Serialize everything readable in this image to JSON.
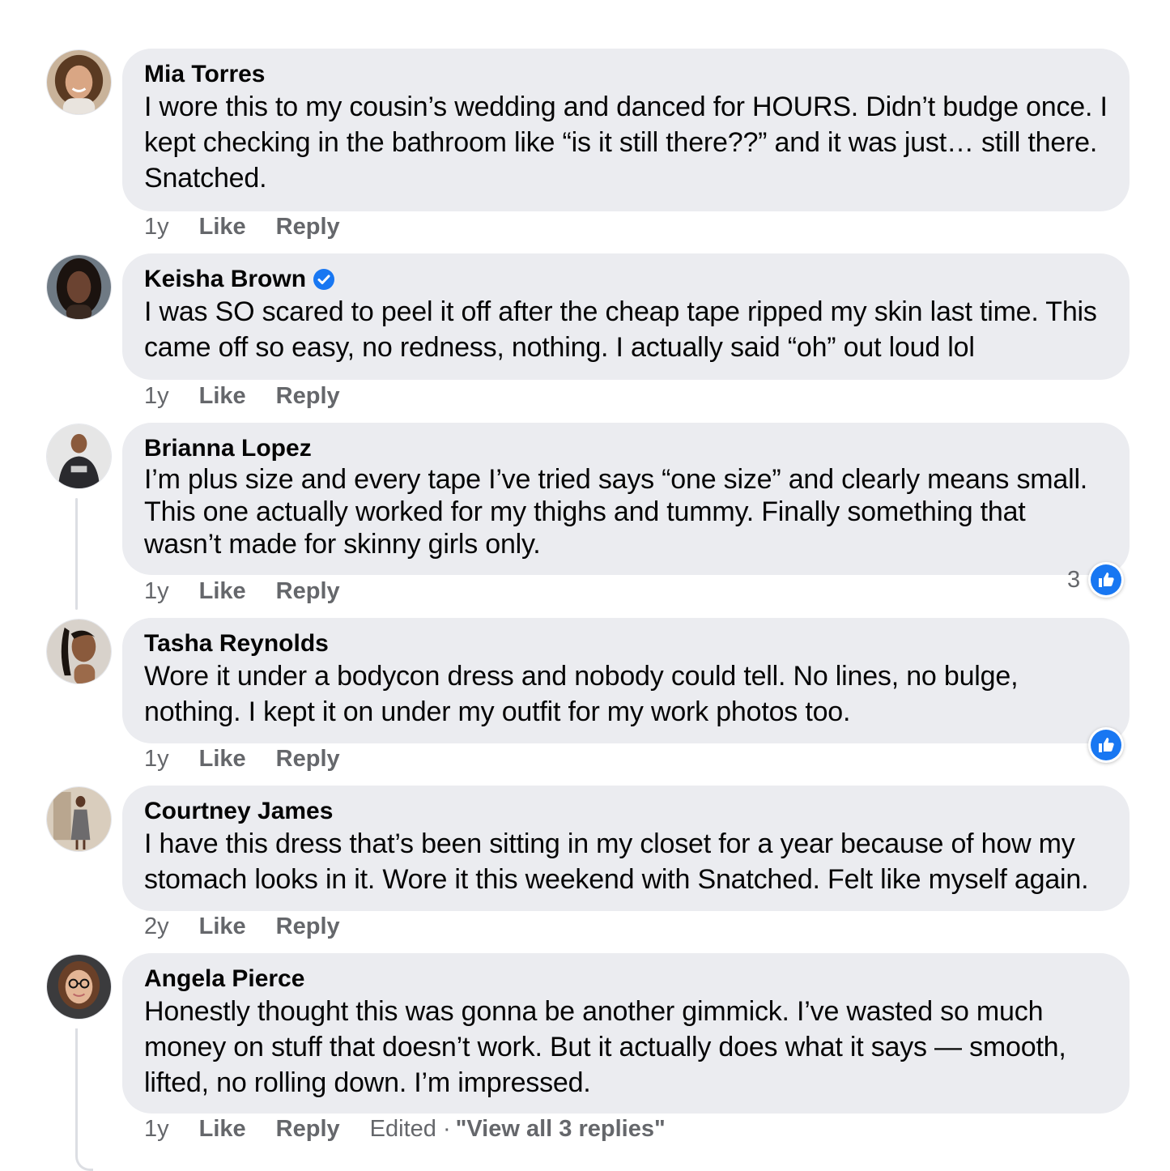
{
  "comments": [
    {
      "name": "Mia Torres",
      "verified": false,
      "text": "I wore this to my cousin’s wedding and danced for HOURS. Didn’t budge once. I kept checking in the bathroom like “is it still there??” and it was just… still there. Snatched.",
      "time": "1y",
      "like": "Like",
      "reply": "Reply"
    },
    {
      "name": "Keisha Brown",
      "verified": true,
      "text": "I was SO scared to peel it off after the cheap tape ripped my skin last time. This came off so easy, no redness, nothing. I actually said “oh” out loud lol",
      "time": "1y",
      "like": "Like",
      "reply": "Reply"
    },
    {
      "name": "Brianna Lopez",
      "verified": false,
      "text": "I’m plus size and every tape I’ve tried says “one size” and clearly means small. This one actually worked for my thighs and tummy. Finally something that wasn’t made for skinny girls only.",
      "time": "1y",
      "like": "Like",
      "reply": "Reply",
      "reaction_count": "3",
      "reaction_icon": "thumbs-up-icon"
    },
    {
      "name": "Tasha Reynolds",
      "verified": false,
      "text": "Wore it under a bodycon dress and nobody could tell. No lines, no bulge, nothing. I kept it on under my outfit for my work photos too.",
      "time": "1y",
      "like": "Like",
      "reply": "Reply",
      "reaction_icon": "thumbs-up-icon"
    },
    {
      "name": "Courtney James",
      "verified": false,
      "text": "I have this dress that’s been sitting in my closet for a year because of how my stomach looks in it. Wore it this weekend with Snatched. Felt like myself again.",
      "time": "2y",
      "like": "Like",
      "reply": "Reply"
    },
    {
      "name": "Angela Pierce",
      "verified": false,
      "text": "Honestly thought this was gonna be another gimmick. I’ve wasted so much money on stuff that doesn’t work. But it actually does what it says — smooth, lifted, no rolling down. I’m impressed.",
      "time": "1y",
      "like": "Like",
      "reply": "Reply",
      "edited": "Edited · ",
      "view_replies": "\"View all 3 replies\""
    }
  ],
  "colors": {
    "bubble": "#ebecf0",
    "meta_text": "#65676b",
    "like_blue": "#1877f2",
    "verified_blue": "#1877f2"
  }
}
